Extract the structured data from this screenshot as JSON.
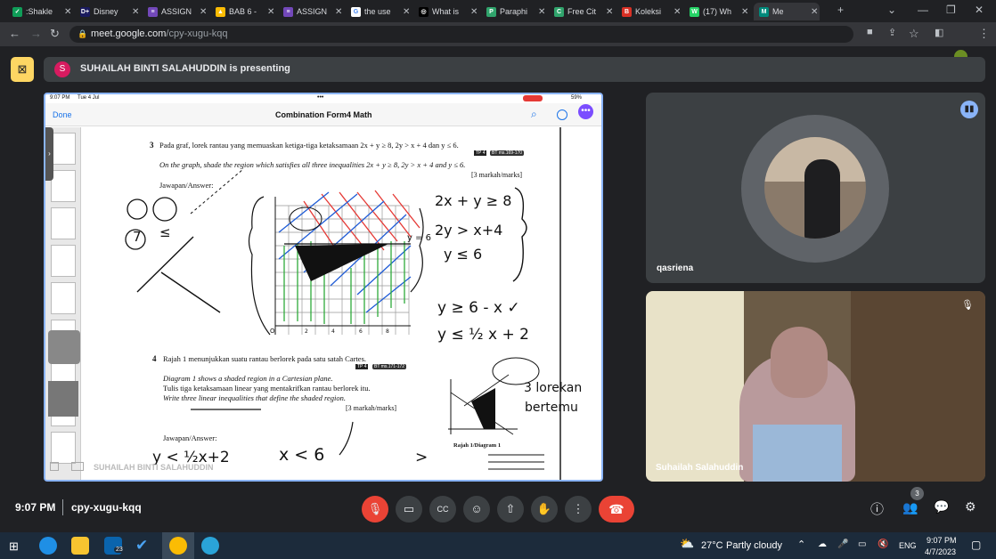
{
  "browser": {
    "tabs": [
      {
        "label": ":Shakle",
        "color": "#0f9d58",
        "glyph": "✓"
      },
      {
        "label": "Disney",
        "color": "#1a1a5e",
        "glyph": "D+"
      },
      {
        "label": "ASSIGN",
        "color": "#7248b9",
        "glyph": "≡"
      },
      {
        "label": "BAB 6 -",
        "color": "#fbbc04",
        "glyph": "▲"
      },
      {
        "label": "ASSIGN",
        "color": "#7248b9",
        "glyph": "≡"
      },
      {
        "label": "the use",
        "color": "#ffffff",
        "glyph": "G"
      },
      {
        "label": "What is",
        "color": "#000000",
        "glyph": "◎"
      },
      {
        "label": "Paraphi",
        "color": "#30a46c",
        "glyph": "P"
      },
      {
        "label": "Free Cit",
        "color": "#30a46c",
        "glyph": "C"
      },
      {
        "label": "Koleksi",
        "color": "#d93025",
        "glyph": "B"
      },
      {
        "label": "(17) Wh",
        "color": "#25d366",
        "glyph": "W"
      },
      {
        "label": "Me",
        "color": "#00897b",
        "glyph": "M"
      }
    ],
    "url_host": "meet.google.com",
    "url_path": "/cpy-xugu-kqq"
  },
  "meet": {
    "presenter_initial": "S",
    "presenting_text": "SUHAILAH BINTI SALAHUDDIN is presenting",
    "share_watermark": "SUHAILAH BINTI SALAHUDDIN",
    "participants": [
      {
        "name": "qasriena"
      },
      {
        "name": "Suhailah Salahuddin"
      }
    ],
    "meeting_time": "9:07 PM",
    "meeting_code": "cpy-xugu-kqq",
    "people_count": "3"
  },
  "ipad": {
    "status_time": "9:07 PM",
    "status_date": "Tue 4 Jul",
    "battery": "59%",
    "done_label": "Done",
    "doc_title": "Combination Form4 Math"
  },
  "doc": {
    "q3_num": "3",
    "q3_text": "Pada graf, lorek rantau yang memuaskan ketiga-tiga ketaksamaan 2x + y ≥ 8, 2y > x + 4 dan y ≤ 6.",
    "q3_tag": "TP 4",
    "q3_ref": "BT ms.169-170",
    "q3_text_en": "On the graph, shade the region which satisfies all three inequalities 2x + y ≥ 8, 2y > x + 4 and y ≤ 6.",
    "q3_marks": "[3 markah/marks]",
    "answer_label": "Jawapan/Answer:",
    "q4_num": "4",
    "q4_text": "Rajah 1 menunjukkan suatu rantau berlorek pada satu satah Cartes.",
    "q4_tag": "TP 4",
    "q4_ref": "BT ms.171-172",
    "q4_text_en": "Diagram 1 shows a shaded region in a Cartesian plane.",
    "q4_text2": "Tulis tiga ketaksamaan linear yang mentakrifkan rantau berlorek itu.",
    "q4_text2_en": "Write three linear inequalities that define the shaded region.",
    "q4_marks": "[3 markah/marks]",
    "answer_label2": "Jawapan/Answer:",
    "diagram_caption": "Rajah 1/Diagram 1",
    "y6_label": "y = 6",
    "graph_ticks": [
      "O",
      "2",
      "4",
      "6",
      "8"
    ]
  },
  "handwriting": {
    "ineq1": "2x + y ≥ 8",
    "ineq2": "2y > x+4",
    "ineq3": "y ≤ 6",
    "rearr1": "y ≥ 6 - x ✓",
    "rearr2": "y ≤ ½ x + 2",
    "note1": "3 lorekan",
    "note2": "bertemu",
    "ans1": "y < ½x+2",
    "ans2": "x < 6",
    "digit7": "7",
    "le": "≤",
    "ge": ">"
  },
  "taskbar": {
    "temp": "27°C",
    "weather": "Partly cloudy",
    "lang": "ENG",
    "time": "9:07 PM",
    "date": "4/7/2023",
    "mail_badge": "23"
  },
  "colors": {
    "accent_blue": "#8ab4f8",
    "end_call_red": "#ea4335",
    "present_yellow": "#fdd663"
  }
}
